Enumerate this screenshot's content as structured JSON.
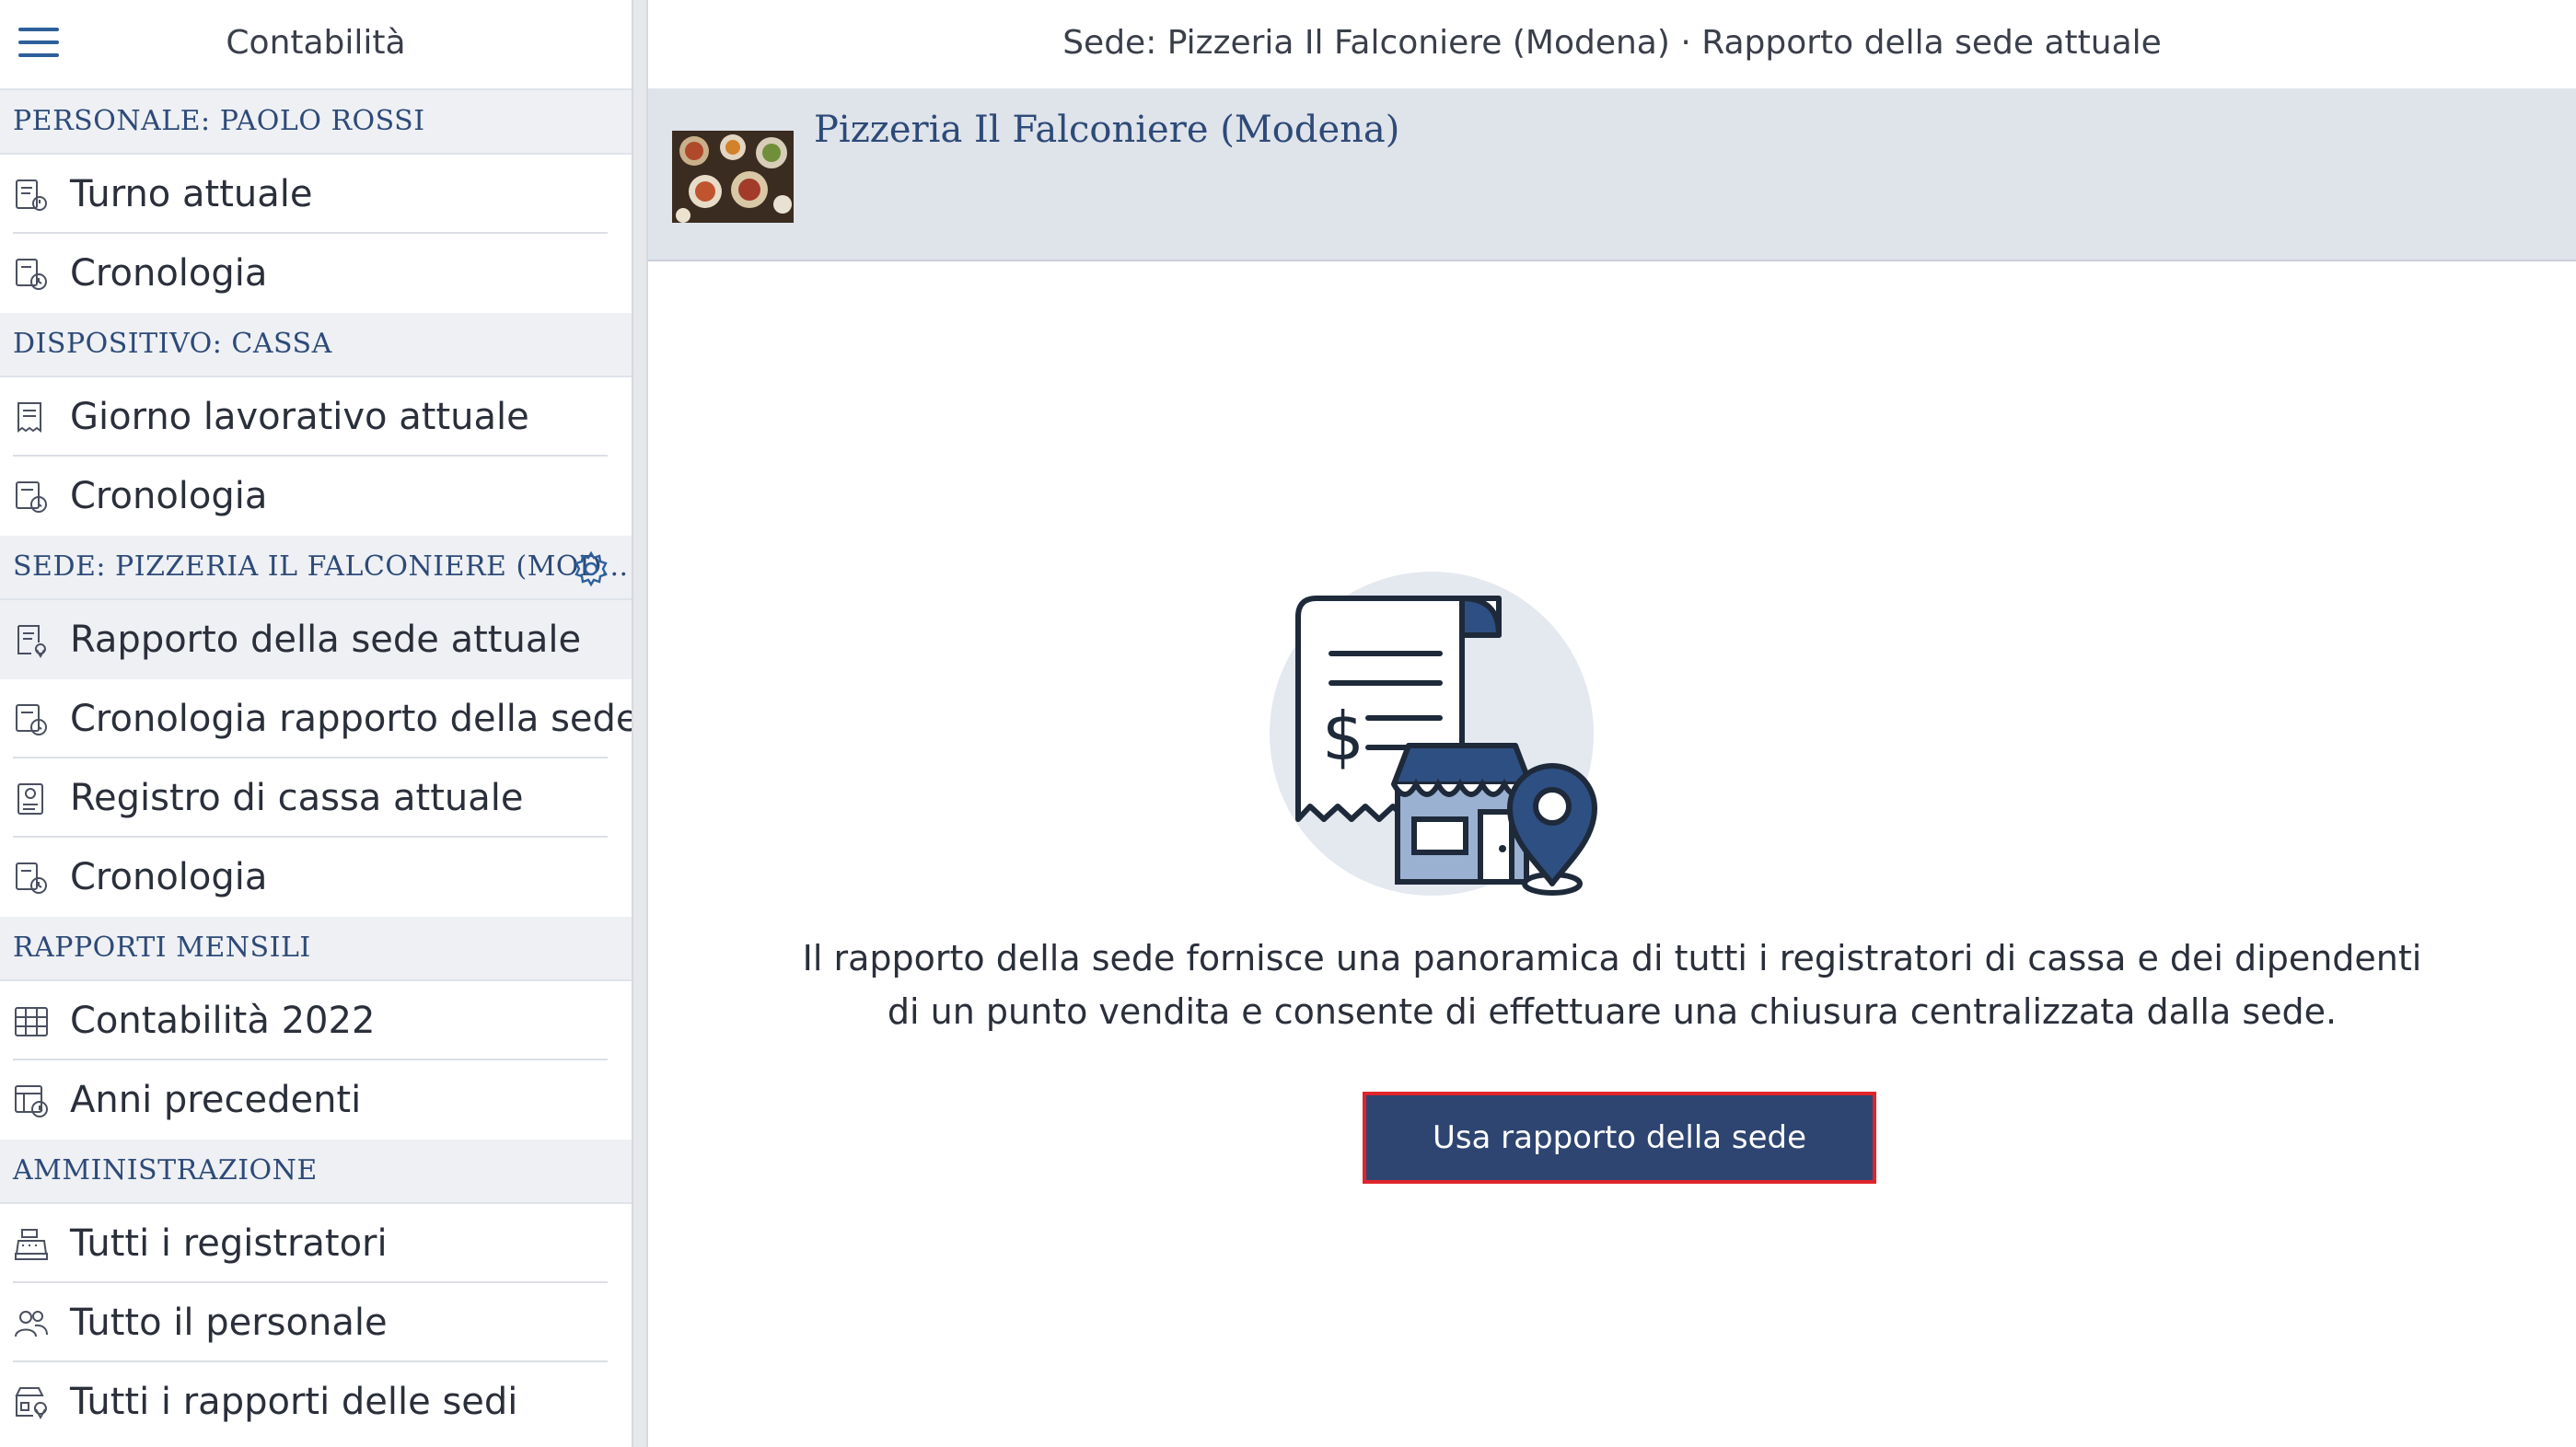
{
  "sidebar": {
    "title": "Contabilità",
    "sections": {
      "personal": {
        "label": "PERSONALE: PAOLO ROSSI"
      },
      "device": {
        "label": "DISPOSITIVO: CASSA"
      },
      "venue": {
        "label": "SEDE: PIZZERIA IL FALCONIERE (MOD..."
      },
      "monthly": {
        "label": "RAPPORTI MENSILI"
      },
      "admin": {
        "label": "AMMINISTRAZIONE"
      }
    },
    "items": [
      {
        "label": "Turno attuale",
        "icon": "shift-receipt-icon"
      },
      {
        "label": "Cronologia",
        "icon": "history-clock-icon"
      },
      {
        "label": "Giorno lavorativo attuale",
        "icon": "receipt-icon"
      },
      {
        "label": "Cronologia",
        "icon": "history-clock-icon"
      },
      {
        "label": "Rapporto della sede attuale",
        "icon": "venue-report-icon"
      },
      {
        "label": "Cronologia rapporto della sede",
        "icon": "history-clock-icon"
      },
      {
        "label": "Registro di cassa attuale",
        "icon": "cash-register-log-icon"
      },
      {
        "label": "Cronologia",
        "icon": "history-clock-icon"
      },
      {
        "label": "Contabilità 2022",
        "icon": "calendar-grid-icon"
      },
      {
        "label": "Anni precedenti",
        "icon": "history-calendar-icon"
      },
      {
        "label": "Tutti i registratori",
        "icon": "cash-register-icon"
      },
      {
        "label": "Tutto il personale",
        "icon": "people-icon"
      },
      {
        "label": "Tutti i rapporti delle sedi",
        "icon": "store-location-icon"
      }
    ]
  },
  "header": {
    "title": "Sede: Pizzeria Il Falconiere (Modena) · Rapporto della sede attuale"
  },
  "venue": {
    "name": "Pizzeria Il Falconiere (Modena)"
  },
  "main": {
    "description_line1": "Il rapporto della sede fornisce una panoramica di tutti i registratori di cassa e dei dipendenti",
    "description_line2": "di un punto vendita e consente di effettuare una chiusura centralizzata dalla sede.",
    "cta_label": "Usa rapporto della sede"
  },
  "colors": {
    "accent": "#2e4572",
    "section_text": "#2d4a78",
    "cta_border": "#e0242b",
    "band": "#dfe3ea"
  }
}
